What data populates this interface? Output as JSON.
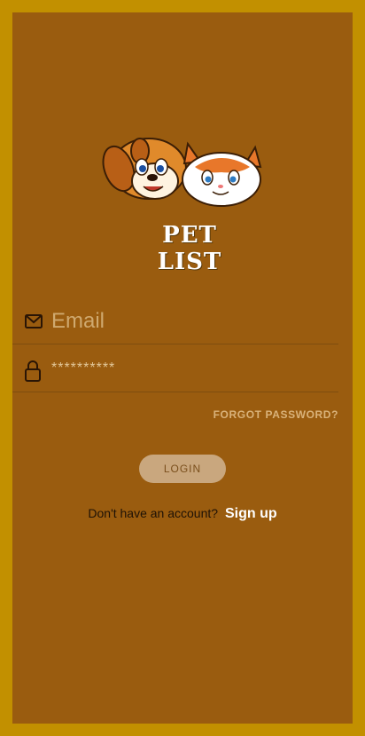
{
  "app": {
    "logo_text": "PET LIST"
  },
  "colors": {
    "outer_border": "#c29000",
    "background": "#9a5c0f",
    "button": "#c9a77e"
  },
  "form": {
    "email_placeholder": "Email",
    "password_value": "**********",
    "forgot_label": "FORGOT PASSWORD?",
    "login_label": "LOGIN",
    "signup_prompt": "Don't have an account?",
    "signup_link": "Sign up"
  },
  "icons": {
    "email": "mail-icon",
    "password": "lock-icon"
  }
}
